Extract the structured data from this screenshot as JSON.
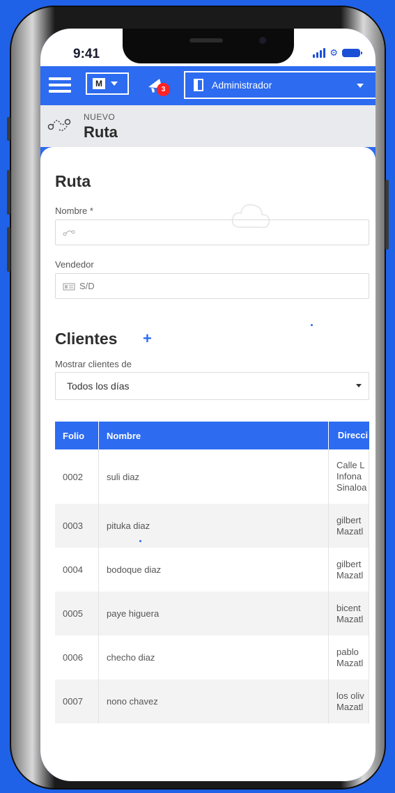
{
  "status_bar": {
    "time": "9:41"
  },
  "topbar": {
    "menu_icon": "hamburger-menu-icon",
    "company_select": "M",
    "notifications_count": "3",
    "profile_select": "Administrador"
  },
  "page_header": {
    "overline": "NUEVO",
    "title": "Ruta"
  },
  "ruta_section": {
    "title": "Ruta",
    "nombre_label": "Nombre *",
    "nombre_value": "",
    "vendedor_label": "Vendedor",
    "vendedor_value": "S/D"
  },
  "clientes_section": {
    "title": "Clientes",
    "add_label": "+",
    "filter_label": "Mostrar clientes de",
    "filter_value": "Todos los días"
  },
  "table": {
    "columns": [
      "Folio",
      "Nombre",
      "Direcci"
    ],
    "rows": [
      {
        "folio": "0002",
        "nombre": "suli diaz",
        "direccion": [
          "Calle L",
          "Infona",
          "Sinaloa"
        ]
      },
      {
        "folio": "0003",
        "nombre": "pituka diaz",
        "direccion": [
          "gilbert",
          "Mazatl"
        ]
      },
      {
        "folio": "0004",
        "nombre": "bodoque diaz",
        "direccion": [
          "gilbert",
          "Mazatl"
        ]
      },
      {
        "folio": "0005",
        "nombre": "paye higuera",
        "direccion": [
          "bicent",
          "Mazatl"
        ]
      },
      {
        "folio": "0006",
        "nombre": "checho diaz",
        "direccion": [
          "pablo",
          "Mazatl"
        ]
      },
      {
        "folio": "0007",
        "nombre": "nono chavez",
        "direccion": [
          "los oliv",
          "Mazatl"
        ]
      }
    ]
  },
  "colors": {
    "accent": "#2d6bf0",
    "badge": "#ff2323",
    "header_bg": "#e9eaed"
  }
}
